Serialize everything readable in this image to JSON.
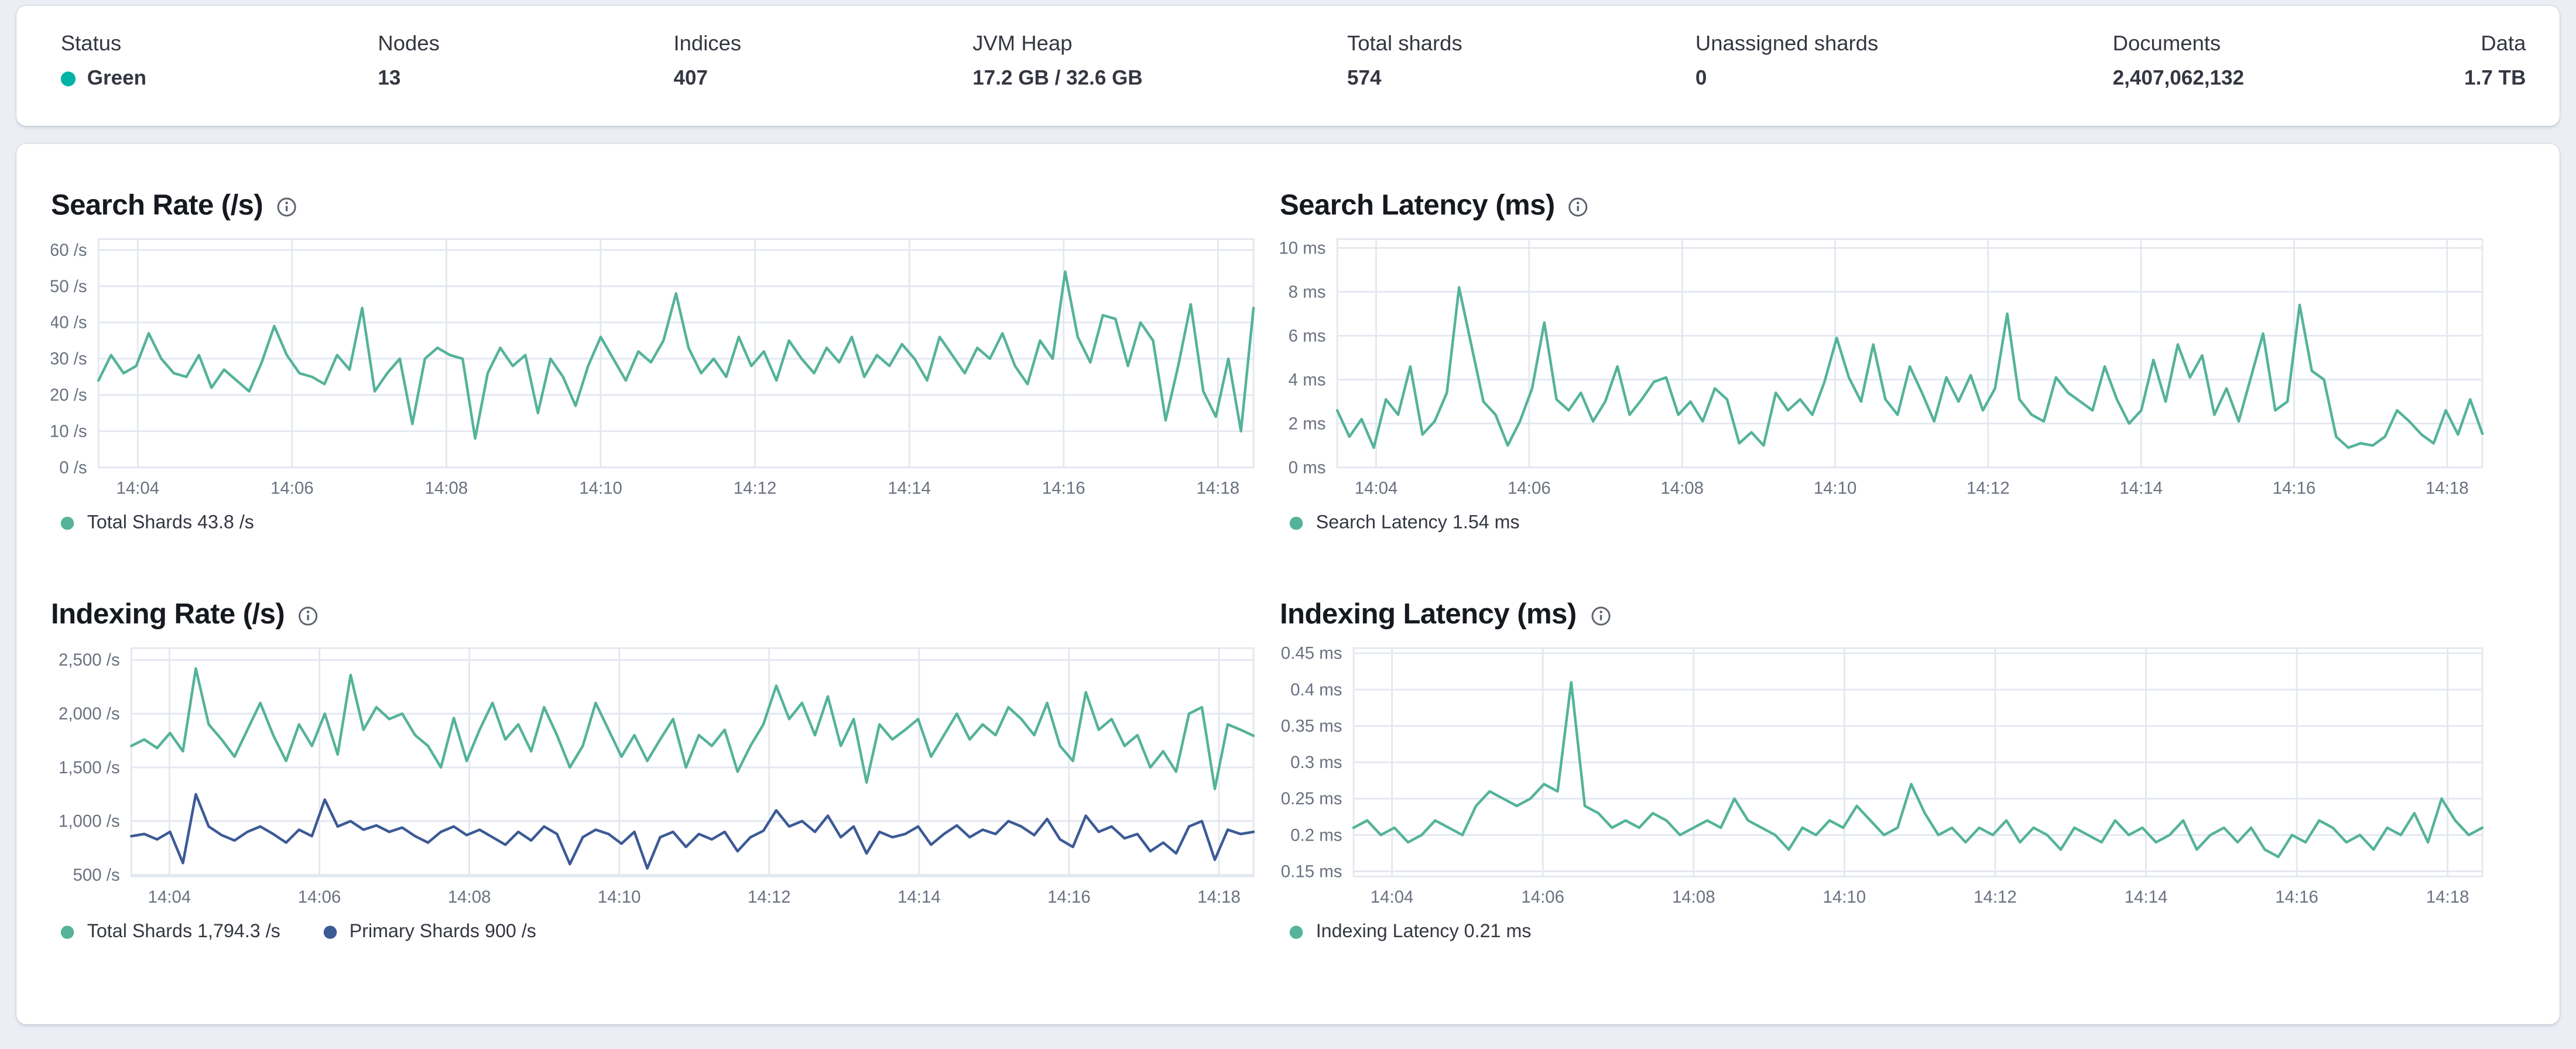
{
  "colors": {
    "teal": "#54b399",
    "navy": "#3c5a96",
    "health_green": "#00b3a4",
    "grid": "#e3e7ef",
    "axis_text": "#6a7180"
  },
  "status_bar": {
    "items": [
      {
        "label": "Status",
        "value": "Green",
        "dot_color": "#00b3a4"
      },
      {
        "label": "Nodes",
        "value": "13"
      },
      {
        "label": "Indices",
        "value": "407"
      },
      {
        "label": "JVM Heap",
        "value": "17.2 GB / 32.6 GB"
      },
      {
        "label": "Total shards",
        "value": "574"
      },
      {
        "label": "Unassigned shards",
        "value": "0"
      },
      {
        "label": "Documents",
        "value": "2,407,062,132"
      },
      {
        "label": "Data",
        "value": "1.7 TB"
      }
    ]
  },
  "chart_data": [
    {
      "type": "line",
      "title": "Search Rate (/s)",
      "ylabel": "/s",
      "ylim": [
        0,
        63
      ],
      "grid": true,
      "legend_position": "bottom",
      "y_ticks": [
        {
          "v": 60,
          "label": "60 /s"
        },
        {
          "v": 50,
          "label": "50 /s"
        },
        {
          "v": 40,
          "label": "40 /s"
        },
        {
          "v": 30,
          "label": "30 /s"
        },
        {
          "v": 20,
          "label": "20 /s"
        },
        {
          "v": 10,
          "label": "10 /s"
        },
        {
          "v": 0,
          "label": "0 /s"
        }
      ],
      "x_ticks": [
        "14:04",
        "14:06",
        "14:08",
        "14:10",
        "14:12",
        "14:14",
        "14:16",
        "14:18"
      ],
      "series": [
        {
          "name": "Total Shards",
          "current_label": "43.8 /s",
          "color": "#54b399",
          "values": [
            24,
            31,
            26,
            28,
            37,
            30,
            26,
            25,
            31,
            22,
            27,
            24,
            21,
            29,
            39,
            31,
            26,
            25,
            23,
            31,
            27,
            44,
            21,
            26,
            30,
            12,
            30,
            33,
            31,
            30,
            8,
            26,
            33,
            28,
            31,
            15,
            30,
            25,
            17,
            28,
            36,
            30,
            24,
            32,
            29,
            35,
            48,
            33,
            26,
            30,
            25,
            36,
            28,
            32,
            24,
            35,
            30,
            26,
            33,
            29,
            36,
            25,
            31,
            28,
            34,
            30,
            24,
            36,
            31,
            26,
            33,
            30,
            37,
            28,
            23,
            35,
            30,
            54,
            36,
            29,
            42,
            41,
            28,
            40,
            35,
            13,
            28,
            45,
            21,
            14,
            30,
            10,
            44
          ]
        }
      ],
      "legend": [
        {
          "color": "#54b399",
          "text": "Total Shards 43.8 /s"
        }
      ]
    },
    {
      "type": "line",
      "title": "Search Latency (ms)",
      "ylabel": "ms",
      "ylim": [
        0,
        10.4
      ],
      "grid": true,
      "legend_position": "bottom",
      "y_ticks": [
        {
          "v": 10,
          "label": "10 ms"
        },
        {
          "v": 8,
          "label": "8 ms"
        },
        {
          "v": 6,
          "label": "6 ms"
        },
        {
          "v": 4,
          "label": "4 ms"
        },
        {
          "v": 2,
          "label": "2 ms"
        },
        {
          "v": 0,
          "label": "0 ms"
        }
      ],
      "x_ticks": [
        "14:04",
        "14:06",
        "14:08",
        "14:10",
        "14:12",
        "14:14",
        "14:16",
        "14:18"
      ],
      "series": [
        {
          "name": "Search Latency",
          "current_label": "1.54 ms",
          "color": "#54b399",
          "values": [
            2.6,
            1.4,
            2.2,
            0.9,
            3.1,
            2.4,
            4.6,
            1.5,
            2.1,
            3.4,
            8.2,
            5.6,
            3.0,
            2.4,
            1.0,
            2.1,
            3.6,
            6.6,
            3.1,
            2.6,
            3.4,
            2.1,
            3.0,
            4.6,
            2.4,
            3.1,
            3.9,
            4.1,
            2.4,
            3.0,
            2.1,
            3.6,
            3.1,
            1.1,
            1.6,
            1.0,
            3.4,
            2.6,
            3.1,
            2.4,
            3.9,
            5.9,
            4.1,
            3.0,
            5.6,
            3.1,
            2.4,
            4.6,
            3.4,
            2.1,
            4.1,
            3.0,
            4.2,
            2.6,
            3.6,
            7.0,
            3.1,
            2.4,
            2.1,
            4.1,
            3.4,
            3.0,
            2.6,
            4.6,
            3.1,
            2.0,
            2.6,
            4.9,
            3.0,
            5.6,
            4.1,
            5.1,
            2.4,
            3.6,
            2.1,
            4.1,
            6.1,
            2.6,
            3.0,
            7.4,
            4.4,
            4.0,
            1.4,
            0.9,
            1.1,
            1.0,
            1.4,
            2.6,
            2.1,
            1.5,
            1.1,
            2.6,
            1.5,
            3.1,
            1.54
          ]
        }
      ],
      "legend": [
        {
          "color": "#54b399",
          "text": "Search Latency 1.54 ms"
        }
      ]
    },
    {
      "type": "line",
      "title": "Indexing Rate (/s)",
      "ylabel": "/s",
      "ylim": [
        485,
        2610
      ],
      "grid": true,
      "legend_position": "bottom",
      "y_ticks": [
        {
          "v": 2500,
          "label": "2,500 /s"
        },
        {
          "v": 2000,
          "label": "2,000 /s"
        },
        {
          "v": 1500,
          "label": "1,500 /s"
        },
        {
          "v": 1000,
          "label": "1,000 /s"
        },
        {
          "v": 500,
          "label": "500 /s"
        }
      ],
      "x_ticks": [
        "14:04",
        "14:06",
        "14:08",
        "14:10",
        "14:12",
        "14:14",
        "14:16",
        "14:18"
      ],
      "series": [
        {
          "name": "Total Shards",
          "current_label": "1,794.3 /s",
          "color": "#54b399",
          "values": [
            1700,
            1760,
            1680,
            1820,
            1650,
            2420,
            1900,
            1760,
            1600,
            1850,
            2100,
            1800,
            1560,
            1900,
            1700,
            2000,
            1620,
            2360,
            1850,
            2060,
            1950,
            2000,
            1800,
            1700,
            1500,
            1960,
            1560,
            1850,
            2100,
            1760,
            1900,
            1650,
            2060,
            1800,
            1500,
            1700,
            2100,
            1850,
            1600,
            1800,
            1560,
            1760,
            1950,
            1500,
            1800,
            1700,
            1850,
            1460,
            1700,
            1900,
            2260,
            1950,
            2100,
            1800,
            2160,
            1700,
            1950,
            1360,
            1900,
            1760,
            1850,
            1950,
            1600,
            1800,
            2000,
            1760,
            1900,
            1800,
            2060,
            1950,
            1800,
            2100,
            1700,
            1560,
            2200,
            1850,
            1950,
            1700,
            1800,
            1500,
            1650,
            1460,
            2000,
            2060,
            1300,
            1900,
            1850,
            1794.3
          ]
        },
        {
          "name": "Primary Shards",
          "current_label": "900 /s",
          "color": "#3c5a96",
          "values": [
            860,
            880,
            830,
            900,
            610,
            1250,
            950,
            870,
            820,
            900,
            950,
            880,
            800,
            920,
            860,
            1200,
            950,
            1000,
            920,
            960,
            900,
            940,
            860,
            800,
            900,
            950,
            870,
            920,
            850,
            780,
            900,
            820,
            950,
            880,
            600,
            850,
            920,
            880,
            790,
            900,
            560,
            850,
            900,
            760,
            880,
            830,
            900,
            720,
            850,
            910,
            1100,
            950,
            1000,
            900,
            1050,
            850,
            950,
            700,
            900,
            850,
            880,
            950,
            780,
            880,
            960,
            850,
            920,
            880,
            1000,
            950,
            870,
            1020,
            830,
            760,
            1050,
            900,
            950,
            840,
            880,
            720,
            800,
            700,
            950,
            1000,
            640,
            920,
            880,
            900
          ]
        }
      ],
      "legend": [
        {
          "color": "#54b399",
          "text": "Total Shards 1,794.3 /s"
        },
        {
          "color": "#3c5a96",
          "text": "Primary Shards 900 /s"
        }
      ]
    },
    {
      "type": "line",
      "title": "Indexing Latency (ms)",
      "ylabel": "ms",
      "ylim": [
        0.143,
        0.457
      ],
      "grid": true,
      "legend_position": "bottom",
      "y_ticks": [
        {
          "v": 0.45,
          "label": "0.45 ms"
        },
        {
          "v": 0.4,
          "label": "0.4 ms"
        },
        {
          "v": 0.35,
          "label": "0.35 ms"
        },
        {
          "v": 0.3,
          "label": "0.3 ms"
        },
        {
          "v": 0.25,
          "label": "0.25 ms"
        },
        {
          "v": 0.2,
          "label": "0.2 ms"
        },
        {
          "v": 0.15,
          "label": "0.15 ms"
        }
      ],
      "x_ticks": [
        "14:04",
        "14:06",
        "14:08",
        "14:10",
        "14:12",
        "14:14",
        "14:16",
        "14:18"
      ],
      "series": [
        {
          "name": "Indexing Latency",
          "current_label": "0.21 ms",
          "color": "#54b399",
          "values": [
            0.21,
            0.22,
            0.2,
            0.21,
            0.19,
            0.2,
            0.22,
            0.21,
            0.2,
            0.24,
            0.26,
            0.25,
            0.24,
            0.25,
            0.27,
            0.26,
            0.41,
            0.24,
            0.23,
            0.21,
            0.22,
            0.21,
            0.23,
            0.22,
            0.2,
            0.21,
            0.22,
            0.21,
            0.25,
            0.22,
            0.21,
            0.2,
            0.18,
            0.21,
            0.2,
            0.22,
            0.21,
            0.24,
            0.22,
            0.2,
            0.21,
            0.27,
            0.23,
            0.2,
            0.21,
            0.19,
            0.21,
            0.2,
            0.22,
            0.19,
            0.21,
            0.2,
            0.18,
            0.21,
            0.2,
            0.19,
            0.22,
            0.2,
            0.21,
            0.19,
            0.2,
            0.22,
            0.18,
            0.2,
            0.21,
            0.19,
            0.21,
            0.18,
            0.17,
            0.2,
            0.19,
            0.22,
            0.21,
            0.19,
            0.2,
            0.18,
            0.21,
            0.2,
            0.23,
            0.19,
            0.25,
            0.22,
            0.2,
            0.21
          ]
        }
      ],
      "legend": [
        {
          "color": "#54b399",
          "text": "Indexing Latency 0.21 ms"
        }
      ]
    }
  ]
}
